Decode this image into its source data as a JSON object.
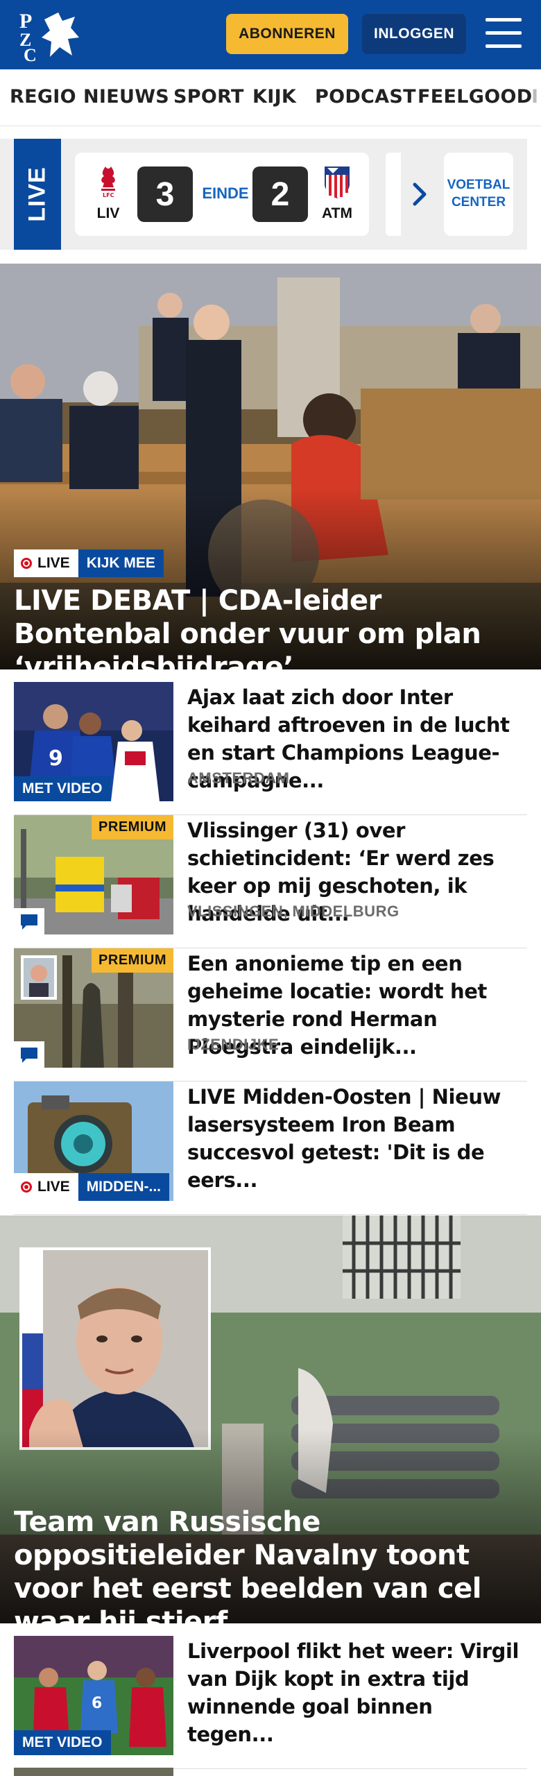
{
  "header": {
    "logo_text": "PZC",
    "subscribe_label": "ABONNEREN",
    "login_label": "INLOGGEN",
    "brand_color": "#0a4a9e",
    "accent_color": "#f5b932",
    "menu_icon": "hamburger-menu-icon"
  },
  "nav": {
    "items": [
      "REGIO",
      "NIEUWS",
      "SPORT",
      "KIJK",
      "PODCAST",
      "FEELGOOD",
      "I"
    ]
  },
  "live": {
    "tab_label": "LIVE",
    "home_code": "LIV",
    "home_score": "3",
    "status": "EINDE",
    "away_score": "2",
    "away_code": "ATM",
    "voetbal_label": "VOETBAL CENTER"
  },
  "hero": {
    "live_label": "LIVE",
    "tag": "KIJK MEE",
    "title": "LIVE DEBAT | CDA-leider Bontenbal onder vuur om plan ‘vrijheidsbijdrage’"
  },
  "articles": [
    {
      "title": "Ajax laat zich door Inter keihard aftroeven in de lucht en start Champions League-campagne...",
      "location": "AMSTERDAM",
      "badge": "MET VIDEO"
    },
    {
      "title": "Vlissinger (31) over schietinci­dent: ‘Er werd zes keer op mij geschoten, ik handelde uit...",
      "location": "VLISSINGEN, MIDDELBURG",
      "premium": "PREMIUM"
    },
    {
      "title": "Een anonieme tip en een geheime locatie: wordt het mysterie rond Herman Ploegstra eindelijk...",
      "location": "IJZENDIJKE",
      "premium": "PREMIUM"
    },
    {
      "title": "LIVE Midden-Oosten | Nieuw lasersysteem Iron Beam succesvol getest: 'Dit is de eers...",
      "live_label": "LIVE",
      "tag": "MIDDEN-..."
    }
  ],
  "big_story": {
    "title": "Team van Russische oppositieleider Navalny toont voor het eerst beelden van cel waar hij stierf"
  },
  "more_articles": [
    {
      "title": "Liverpool flikt het weer: Virgil van Dijk kopt in extra tijd winnende goal binnen tegen...",
      "badge": "MET VIDEO"
    }
  ]
}
